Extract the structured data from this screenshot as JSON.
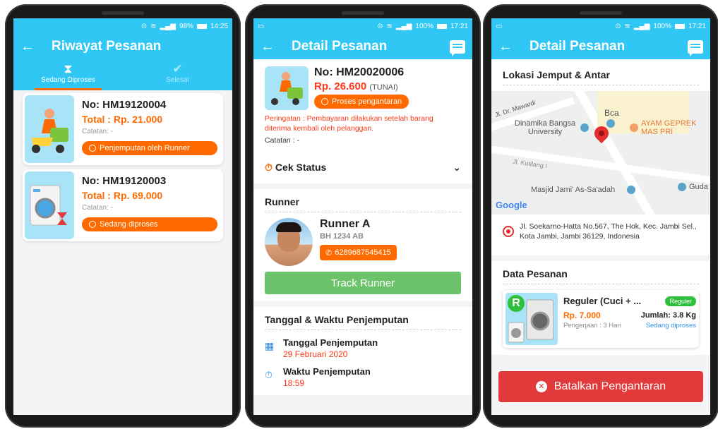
{
  "colors": {
    "primary": "#31c7f5",
    "accent": "#ff6a00",
    "danger": "#e23a3a",
    "success": "#6cc36c"
  },
  "screen1": {
    "status": {
      "battery": "98%",
      "time": "14:25"
    },
    "title": "Riwayat Pesanan",
    "tabs": [
      {
        "label": "Sedang Diproses",
        "icon": "hourglass-icon"
      },
      {
        "label": "Selesai",
        "icon": "check-circle-icon"
      }
    ],
    "orders": [
      {
        "no": "No: HM19120004",
        "total": "Total : Rp. 21.000",
        "note": "Catatan: -",
        "status": "Penjemputan oleh Runner"
      },
      {
        "no": "No: HM19120003",
        "total": "Total : Rp. 69.000",
        "note": "Catatan: -",
        "status": "Sedang diproses"
      }
    ]
  },
  "screen2": {
    "status": {
      "battery": "100%",
      "time": "17:21"
    },
    "title": "Detail Pesanan",
    "order_no": "No: HM20020006",
    "price": "Rp. 26.600",
    "payment": "(TUNAI)",
    "status_pill": "Proses pengantaran",
    "warning": "Peringatan : Pembayaran dilakukan setelah barang diterima kembali oleh pelanggan.",
    "note": "Catatan : -",
    "cek_status": "Cek Status",
    "runner_title": "Runner",
    "runner_name": "Runner A",
    "runner_plate": "BH 1234 AB",
    "runner_phone": "6289687545415",
    "track_label": "Track Runner",
    "pickup_title": "Tanggal & Waktu Penjemputan",
    "pickup_date_label": "Tanggal Penjemputan",
    "pickup_date": "29 Februari 2020",
    "pickup_time_label": "Waktu Penjemputan",
    "pickup_time": "18:59"
  },
  "screen3": {
    "status": {
      "battery": "100%",
      "time": "17:21"
    },
    "title": "Detail Pesanan",
    "location_title": "Lokasi Jemput & Antar",
    "map_labels": {
      "road1": "Jl. Dr. Mawardi",
      "poi1": "Dinamika Bangsa University",
      "poi2": "Bca",
      "poi3": "AYAM GEPREK MAS PRI",
      "road2": "Jl. Kutilang I",
      "poi4": "Masjid Jami' As-Sa'adah",
      "poi5": "Guda",
      "logo": "Google"
    },
    "address": "Jl. Soekarno-Hatta No.567, The Hok, Kec. Jambi Sel., Kota Jambi, Jambi 36129, Indonesia",
    "data_title": "Data Pesanan",
    "item_name": "Reguler (Cuci + ...",
    "item_badge": "Reguler",
    "item_price": "Rp. 7.000",
    "item_qty": "Jumlah: 3.8 Kg",
    "item_duration": "Pengerjaan : 3 Hari",
    "item_status": "Sedang diproses",
    "thumb_letter": "R",
    "cancel_label": "Batalkan Pengantaran"
  }
}
